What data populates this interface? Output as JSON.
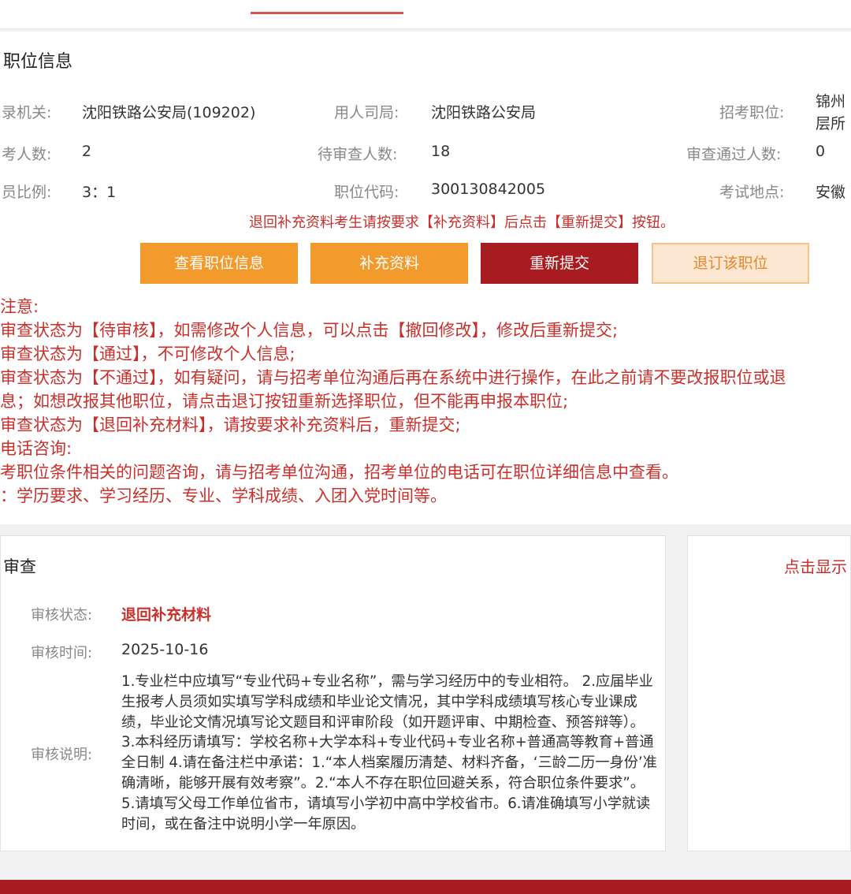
{
  "section_title": "职位信息",
  "info": {
    "row1": {
      "label1": "录机关:",
      "value1": "沈阳铁路公安局(109202)",
      "label2": "用人司局:",
      "value2": "沈阳铁路公安局",
      "label3": "招考职位:",
      "value3_line1": "锦州",
      "value3_line2": "层所"
    },
    "row2": {
      "label1": "考人数:",
      "value1": "2",
      "label2": "待审查人数:",
      "value2": "18",
      "label3": "审查通过人数:",
      "value3": "0"
    },
    "row3": {
      "label1": "员比例:",
      "value1": "3：1",
      "label2": "职位代码:",
      "value2": "300130842005",
      "label3": "考试地点:",
      "value3": "安徽"
    }
  },
  "hint": "退回补充资料考生请按要求【补充资料】后点击【重新提交】按钮。",
  "buttons": {
    "view_position": "查看职位信息",
    "supplement": "补充资料",
    "resubmit": "重新提交",
    "withdraw": "退订该职位"
  },
  "notes": [
    "注意:",
    "审查状态为【待审核】，如需修改个人信息，可以点击【撤回修改】，修改后重新提交;",
    "审查状态为【通过】，不可修改个人信息;",
    "审查状态为【不通过】，如有疑问，请与招考单位沟通后再在系统中进行操作，在此之前请不要改报职位或退",
    "息；如想改报其他职位，请点击退订按钮重新选择职位，但不能再申报本职位;",
    "审查状态为【退回补充材料】，请按要求补充资料后，重新提交;",
    "电话咨询:",
    "考职位条件相关的问题咨询，请与招考单位沟通，招考单位的电话可在职位详细信息中查看。",
    "：学历要求、学习经历、专业、学科成绩、入团入党时间等。"
  ],
  "review": {
    "title": "审查",
    "status_label": "审核状态:",
    "status_value": "退回补充材料",
    "time_label": "审核时间:",
    "time_value": "2025-10-16",
    "desc_label": "审核说明:",
    "desc_value": "1.专业栏中应填写“专业代码+专业名称”，需与学习经历中的专业相符。 2.应届毕业生报考人员须如实填写学科成绩和毕业论文情况，其中学科成绩填写核心专业课成绩，毕业论文情况填写论文题目和评审阶段（如开题评审、中期检查、预答辩等）。 3.本科经历请填写：学校名称+大学本科+专业代码+专业名称+普通高等教育+普通全日制 4.请在备注栏中承诺：1.“本人档案履历清楚、材料齐备，‘三龄二历一身份’准确清晰，能够开展有效考察”。2.“本人不存在职位回避关系，符合职位条件要求”。5.请填写父母工作单位省市，请填写小学初中高中学校省市。6.请准确填写小学就读时间，或在备注中说明小学一年原因。"
  },
  "side": {
    "link": "点击显示"
  },
  "colors": {
    "accent_red": "#c9302c",
    "dark_red": "#a81b20",
    "orange": "#f39a2c",
    "light_orange": "#fde6d2"
  }
}
